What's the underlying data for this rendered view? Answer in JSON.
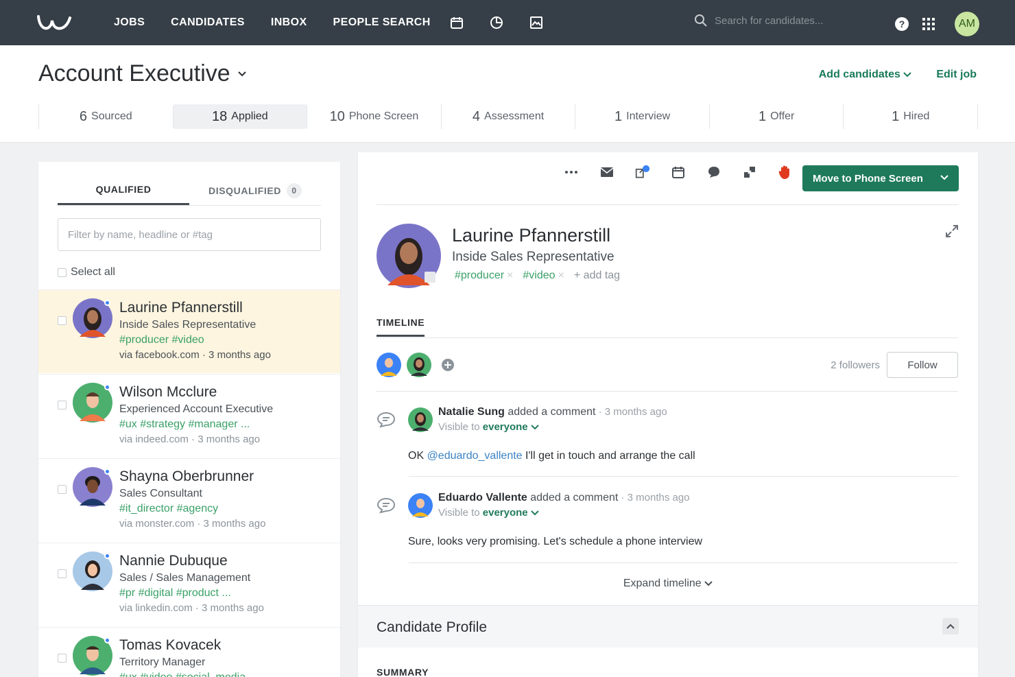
{
  "nav": {
    "items": [
      "JOBS",
      "CANDIDATES",
      "INBOX",
      "PEOPLE SEARCH"
    ],
    "icons": [
      "calendar-icon",
      "pie-chart-icon",
      "image-report-icon"
    ],
    "search_placeholder": "Search for candidates...",
    "user_initials": "AM"
  },
  "header": {
    "job_title": "Account Executive",
    "add_candidates": "Add candidates",
    "edit_job": "Edit job",
    "stages": [
      {
        "count": "6",
        "label": "Sourced"
      },
      {
        "count": "18",
        "label": "Applied"
      },
      {
        "count": "10",
        "label": "Phone Screen"
      },
      {
        "count": "4",
        "label": "Assessment"
      },
      {
        "count": "1",
        "label": "Interview"
      },
      {
        "count": "1",
        "label": "Offer"
      },
      {
        "count": "1",
        "label": "Hired"
      }
    ]
  },
  "list": {
    "tab_qualified": "QUALIFIED",
    "tab_disqualified": "DISQUALIFIED",
    "disqualified_count": "0",
    "filter_placeholder": "Filter by name, headline or #tag",
    "select_all": "Select all",
    "candidates": [
      {
        "name": "Laurine Pfannerstill",
        "role": "Inside Sales Representative",
        "tags": "#producer #video",
        "source": "via facebook.com · 3 months ago"
      },
      {
        "name": "Wilson Mcclure",
        "role": "Experienced Account Executive",
        "tags": "#ux #strategy #manager ...",
        "source": "via indeed.com · 3 months ago"
      },
      {
        "name": "Shayna Oberbrunner",
        "role": "Sales Consultant",
        "tags": "#it_director #agency",
        "source": "via monster.com · 3 months ago"
      },
      {
        "name": "Nannie Dubuque",
        "role": "Sales / Sales Management",
        "tags": "#pr #digital #product ...",
        "source": "via linkedin.com · 3 months ago"
      },
      {
        "name": "Tomas Kovacek",
        "role": "Territory Manager",
        "tags": "#ux #video #social_media",
        "source": ""
      }
    ]
  },
  "detail": {
    "move_button": "Move to Phone Screen",
    "name": "Laurine Pfannerstill",
    "role": "Inside Sales Representative",
    "tag1": "#producer",
    "tag2": "#video",
    "add_tag": "+ add tag",
    "timeline_label": "TIMELINE",
    "followers": "2 followers",
    "follow": "Follow",
    "comments": [
      {
        "author": "Natalie Sung",
        "action": " added a comment",
        "time": " · 3 months ago",
        "visible": "Visible to ",
        "audience": "everyone",
        "mention": "@eduardo_vallente",
        "pre": "OK ",
        "text": " I'll get in touch and arrange the call"
      },
      {
        "author": "Eduardo Vallente",
        "action": " added a comment",
        "time": " · 3 months ago",
        "visible": "Visible to ",
        "audience": "everyone",
        "text": "Sure, looks very promising. Let's schedule a phone interview"
      }
    ],
    "expand_timeline": "Expand timeline",
    "candidate_profile": "Candidate Profile",
    "summary": "SUMMARY"
  },
  "colors": {
    "topbar": "#363f47",
    "accent": "#1f7a5c",
    "tag": "#3aa067",
    "selected_row": "#fdf5df"
  }
}
